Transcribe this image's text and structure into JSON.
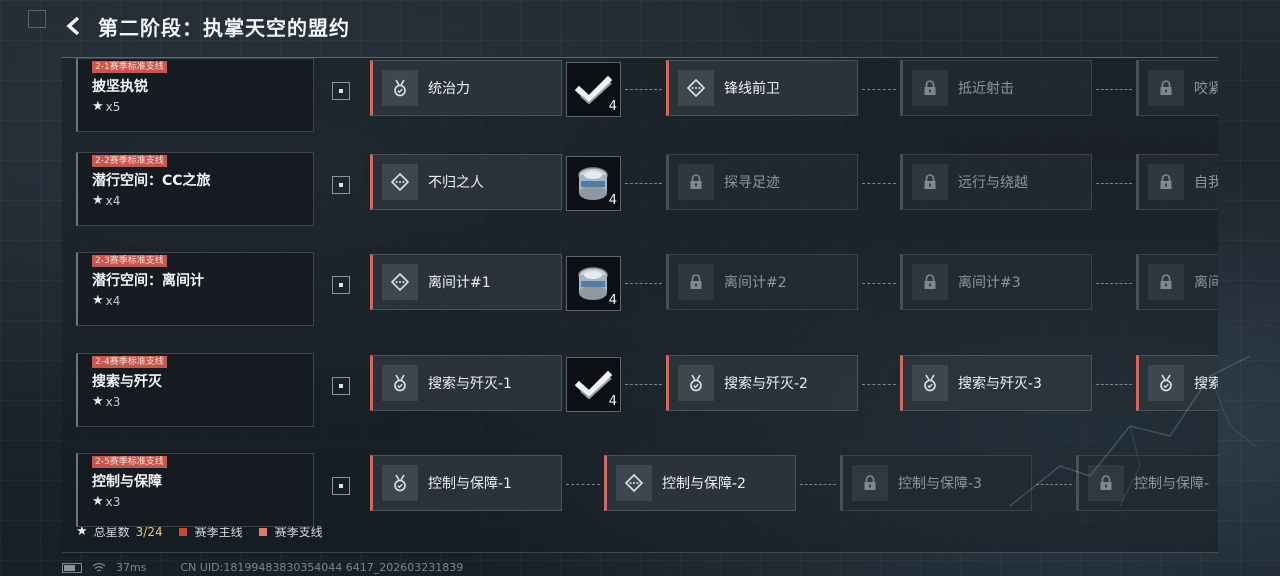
{
  "header": {
    "title": "第二阶段：执掌天空的盟约"
  },
  "stages": [
    {
      "tag": "2-1赛季标准支线",
      "name": "披坚执锐",
      "stars": "x5",
      "reward": {
        "type": "check",
        "count": "4"
      },
      "nodes": [
        {
          "label": "统治力",
          "icon": "medal-icon",
          "state": "unlocked"
        },
        {
          "label": "锋线前卫",
          "icon": "diamond-dots-icon",
          "state": "unlocked"
        },
        {
          "label": "抵近射击",
          "icon": "lock-icon",
          "state": "locked"
        },
        {
          "label": "咬紧",
          "icon": "lock-icon",
          "state": "locked"
        }
      ]
    },
    {
      "tag": "2-2赛季标准支线",
      "name": "潜行空间：CC之旅",
      "stars": "x4",
      "reward": {
        "type": "can",
        "count": "4"
      },
      "nodes": [
        {
          "label": "不归之人",
          "icon": "diamond-dots-icon",
          "state": "unlocked"
        },
        {
          "label": "探寻足迹",
          "icon": "lock-icon",
          "state": "locked"
        },
        {
          "label": "远行与绕越",
          "icon": "lock-icon",
          "state": "locked"
        },
        {
          "label": "自我",
          "icon": "lock-icon",
          "state": "locked"
        }
      ]
    },
    {
      "tag": "2-3赛季标准支线",
      "name": "潜行空间：离间计",
      "stars": "x4",
      "reward": {
        "type": "can",
        "count": "4"
      },
      "nodes": [
        {
          "label": "离间计#1",
          "icon": "diamond-dots-icon",
          "state": "unlocked"
        },
        {
          "label": "离间计#2",
          "icon": "lock-icon",
          "state": "locked"
        },
        {
          "label": "离间计#3",
          "icon": "lock-icon",
          "state": "locked"
        },
        {
          "label": "离间",
          "icon": "lock-icon",
          "state": "locked"
        }
      ]
    },
    {
      "tag": "2-4赛季标准支线",
      "name": "搜索与歼灭",
      "stars": "x3",
      "reward": {
        "type": "check",
        "count": "4"
      },
      "nodes": [
        {
          "label": "搜索与歼灭-1",
          "icon": "medal-icon",
          "state": "unlocked"
        },
        {
          "label": "搜索与歼灭-2",
          "icon": "medal-icon",
          "state": "unlocked"
        },
        {
          "label": "搜索与歼灭-3",
          "icon": "medal-icon",
          "state": "unlocked"
        },
        {
          "label": "搜索",
          "icon": "medal-icon",
          "state": "unlocked"
        }
      ]
    },
    {
      "tag": "2-5赛季标准支线",
      "name": "控制与保障",
      "stars": "x3",
      "reward": null,
      "nodes": [
        {
          "label": "控制与保障-1",
          "icon": "medal-icon",
          "state": "unlocked"
        },
        {
          "label": "控制与保障-2",
          "icon": "diamond-dots-icon",
          "state": "unlocked"
        },
        {
          "label": "控制与保障-3",
          "icon": "lock-icon",
          "state": "locked"
        },
        {
          "label": "控制与保障-",
          "icon": "lock-icon",
          "state": "locked"
        }
      ]
    }
  ],
  "legend": {
    "label": "总星数",
    "value": "3/24",
    "items": [
      {
        "label": "赛季主线",
        "color": "#c8463c"
      },
      {
        "label": "赛季支线",
        "color": "#e07a6e"
      }
    ]
  },
  "footer": {
    "ping": "37ms",
    "uid": "CN UID:18199483830354044 6417_202603231839"
  },
  "colors": {
    "accent": "#d06a5e",
    "tag": "#c8564c",
    "star_count": "#e8c870"
  }
}
